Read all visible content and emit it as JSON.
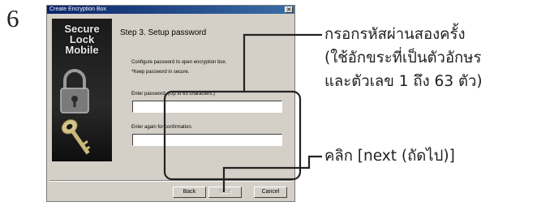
{
  "step_number": "6",
  "window": {
    "title": "Create Encryption Box",
    "close_glyph": "✕",
    "brand": [
      "Secure",
      "Lock",
      "Mobile"
    ],
    "step_title": "Step 3. Setup password",
    "description": [
      "Configure password to open encryption box.",
      "*Keep password in secure."
    ],
    "password_label": "Enter password. (Up to 63 characters.)",
    "confirm_label": "Enter again for confirmation.",
    "password_value": "",
    "confirm_value": "",
    "buttons": {
      "back": "Back",
      "next": "Next",
      "cancel": "Cancel"
    }
  },
  "callouts": {
    "password": [
      "กรอกรหัสผ่านสองครั้ง",
      "(ใช้อักขระที่เป็นตัวอักษร",
      "และตัวเลข 1 ถึง 63 ตัว)"
    ],
    "next": "คลิก [next (ถัดไป)]"
  },
  "colors": {
    "titlebar": "#0a246a",
    "dialog": "#d4d0c8",
    "callout_line": "#222222"
  }
}
